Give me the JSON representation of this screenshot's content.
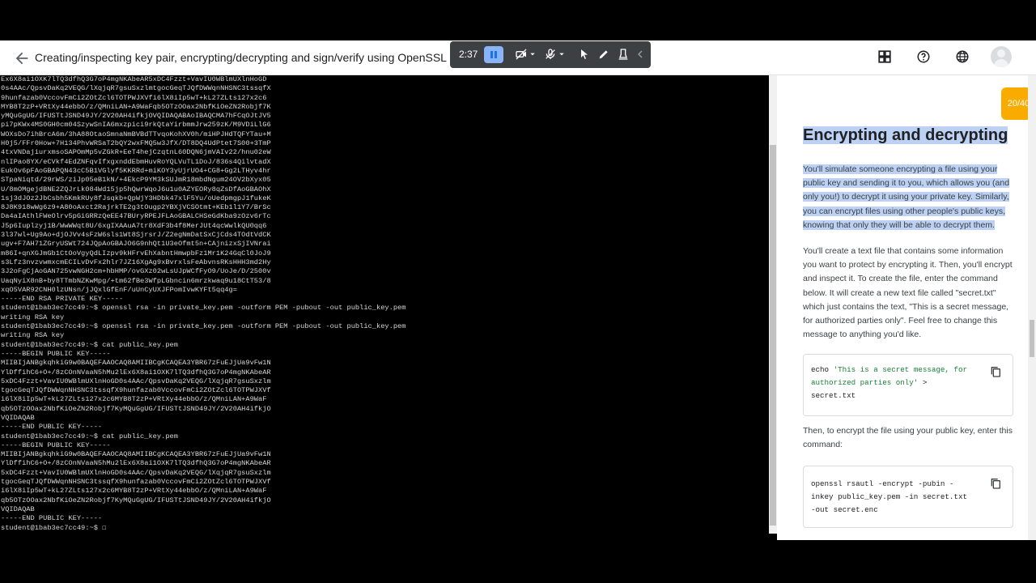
{
  "header": {
    "title": "Creating/inspecting key pair, encrypting/decrypting and sign/verify using OpenSSL"
  },
  "recorder": {
    "time": "2:37"
  },
  "terminal": {
    "lines": [
      "Ex6X8ai1OXK7lTQ3dfhQ3G7oP4mgNKAbeAR5xDC4Fzzt+VavIU0WBlmUXlnHoGD",
      "0s4AAc/QpsvDaKq2VEQG/lXqjqR7gsuSxzlmtgocGeqTJQfDWWqnNHSNC3tssqfX",
      "9hunfazab0VccovFmCi2ZOtZcl6TOTPWJXVfi6lX8iIp5wT+kL27ZLts127x2c6",
      "MYB8T2zP+VRtXy44ebbO/z/QMniLAN+A9WaFqb5OTzOOax2NbfKiOeZN2Robjf7K",
      "yMQuGgUG/IFUSTtJSND49JY/2V20AH4ifkjOVQIDAQABAoIBAQCMA7hFCqOJtJV5",
      "pi7pKWx4MS0GH0cm04SzywSnIA6mxzpici9rkQtaYirbmmJrw259zK/M9VDiLlG6",
      "WOXsDo7ihBrcA6m/3hA88OtaoSmnaNmBVBdTTvqoKohXV0h/miHPJHdTQFYTau+M",
      "H0j5/FFr0How+7H134PhvWRSaT2bQY2wxFMQ5w3JfX/DT8DQ4UdPtet7S00+3TmP",
      "4txVNDajiurxmsoSAPOmMp5vZGkR+EeT4hejCzqtnL60DQN6jmVAIv22/hnu02eW",
      "nlIPao8YX/eCVkf4EdZNFqvIfxgxnddEbmHuvRoYQLVuTL1DoJ/836s4QilvtadX",
      "EukOv6pFAoGBAPQN43cC5B1VGlyf5KKRRd+miKOY3yUjrUO4+CG8+Gg2LTHyv4hr",
      "STpaNiqtd/29rWS/ziJp05eB1kN/+4EkcP9YM3kSUJmR18mbdNgum24OV2bXyx05",
      "U/8mOMgejdBNE2ZQJrLk084Wd15jp5hQwrWqoJ6u1u0AZYEORy8qZsDfAoGBAOhX",
      "1sj3dJOz2JbCsbh5KmkRUy8fJsqkb+QpWjY3HDbk47xlF5Yu/oUedpmgpJ1fukeK",
      "8J8K918wWg6z9+A80oAxct2RajrkTE2g3tOugp2YBXjVCSOtmt+KEb1l1Y7/BrSc",
      "Da4aIAthlFWeOlrv5pGiGRRzQeEE47BUryRPEJFLAoGBALCHSeGdKba9zOzv6rTc",
      "J5p6Iuplzyj1B/WwWWqt8U/6xgIXAAuA7tr8XdF3b4f8MerJUt4qcWwlkQU0qq6",
      "3l37wl+Ug9Ao+djOJVv4sFzW6sls1Wt8SjrsrJ/Z2egNmDatSxCjCds4TOdtVdCK",
      "ugv+F7AH71ZGryUSWt724JQpAoGBAJO6G9nhQt1U3eOfmt5n+CAjnizxSjIVNrai",
      "m86I+qnXGJmGb1CtOoVgyQdLIzpv9kHFrvEhXabntHmwpbFz1Mr1K24GqCl0JoJ9",
      "s3Lfz3nvzvwmxcmECILvDvFx2hlr7JZ16XgAg9xBvrxlsFeAbvnsRKsHHH3md2Hy",
      "3J2oFgCjAoGAN725vwNGH2cm+hbHMP/ovGXz02wLsUJpWCfFyO9/UoJe/D/2500v",
      "UaqNyiX8nB+by8TTmbNZKwMpg/+tm62fBe3WfpLGbncin6mrzkwaq9u18CtT53/8",
      "xqO5VAR92CNH0lzUNsn/jJQxlGfEnF/uUnCyUXJFPomIvwKYFt5qq4g=",
      "-----END RSA PRIVATE KEY-----",
      "student@1bab3ec7cc49:~$ openssl rsa -in private_key.pem -outform PEM -pubout -out public_key.pem",
      "writing RSA key",
      "student@1bab3ec7cc49:~$ openssl rsa -in private_key.pem -outform PEM -pubout -out public_key.pem",
      "writing RSA key",
      "student@1bab3ec7cc49:~$ cat public_key.pem",
      "-----BEGIN PUBLIC KEY-----",
      "MIIBIjANBgkqhkiG9w0BAQEFAAOCAQ8AMIIBCgKCAQEA3YBR67zFuEJjUa9vFw1N",
      "YlDffihC6+O+/8zCOnNVaaN5hMu2lEx6X8ai1OXK7lTQ3dfhQ3G7oP4mgNKAbeAR",
      "5xDC4Fzzt+VavIU0WBlmUXlnHoGD0s4AAc/QpsvDaKq2VEQG/lXqjqR7gsuSxzlm",
      "tgocGeqTJQfDWWqnNHSNC3tssqfX9hunfazab0VccovFmCi2ZOtZcl6TOTPWJXVf",
      "i6lX8iIp5wT+kL27ZLts127x2c6MYB8T2zP+VRtXy44ebbO/z/QMniLAN+A9WaF",
      "qb5OTzOOax2NbfKiOeZN2Robjf7KyMQuGgUG/IFUSTtJSND49JY/2V20AH4ifkjO",
      "VQIDAQAB",
      "-----END PUBLIC KEY-----",
      "student@1bab3ec7cc49:~$ cat public_key.pem",
      "-----BEGIN PUBLIC KEY-----",
      "MIIBIjANBgkqhkiG9w0BAQEFAAOCAQ8AMIIBCgKCAQEA3YBR67zFuEJjUa9vFw1N",
      "YlDffihC6+O+/8zCOnNVaaN5hMu2lEx6X8ai1OXK7lTQ3dfhQ3G7oP4mgNKAbeAR",
      "5xDC4Fzzt+VavIU0WBlmUXlnHoGD0s4AAc/QpsvDaKq2VEQG/lXqjqR7gsuSxzlm",
      "tgocGeqTJQfDWWqnNHSNC3tssqfX9hunfazab0VccovFmCi2ZOtZcl6TOTPWJXVf",
      "i6lX8iIp5wT+kL27ZLts127x2c6MYB8T2zP+VRtXy44ebbO/z/QMniLAN+A9WaF",
      "qb5OTzOOax2NbfKiOeZN2Robjf7KyMQuGgUG/IFUSTtJSND49JY/2V20AH4ifkjO",
      "VQIDAQAB",
      "-----END PUBLIC KEY-----",
      "student@1bab3ec7cc49:~$ ☐"
    ]
  },
  "lab": {
    "progress": "20/40",
    "heading": "Encrypting and decrypting",
    "para1": "You'll simulate someone encrypting a file using your public key and sending it to you, which allows you (and only you!) to decrypt it using your private key. Similarly, you can encrypt files using other people's public keys, knowing that only they will be able to decrypt them.",
    "para2": "You'll create a text file that contains some information you want to protect by encrypting it. Then, you'll encrypt and inspect it. To create the file, enter the command below. It will create a new text file called \"secret.txt\" which just contains the text, \"This is a secret message, for authorized parties only\". Feel free to change this message to anything you'd like.",
    "code1": {
      "l1a": "echo ",
      "l1b": "'This is a secret message, for",
      "l2": "authorized parties only'",
      "l2b": " >",
      "l3": "secret.txt"
    },
    "para3": "Then, to encrypt the file using your public key, enter this command:",
    "code2": {
      "l1": "openssl rsautl -encrypt -pubin -",
      "l2": "inkey public_key.pem -in secret.txt",
      "l3": "-out secret.enc"
    }
  }
}
